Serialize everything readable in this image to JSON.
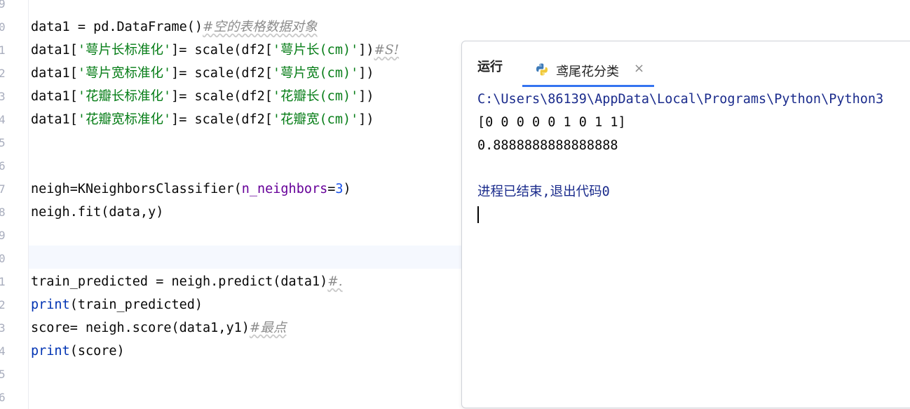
{
  "editor": {
    "line_numbers": [
      "9",
      "0",
      "1",
      "2",
      "3",
      "4",
      "5",
      "6",
      "7",
      "8",
      "9",
      "0",
      "1",
      "2",
      "3",
      "4",
      "5",
      "6"
    ],
    "lines": {
      "l1": {
        "a": "data1 = pd.DataFrame()",
        "c": "#空的表格数据对象"
      },
      "l2": {
        "a": "data1[",
        "s1": "'萼片长标准化'",
        "b": "]= scale(df2[",
        "s2": "'萼片长(cm)'",
        "d": "])",
        "c": "#S!"
      },
      "l3": {
        "a": "data1[",
        "s1": "'萼片宽标准化'",
        "b": "]= scale(df2[",
        "s2": "'萼片宽(cm)'",
        "d": "])"
      },
      "l4": {
        "a": "data1[",
        "s1": "'花瓣长标准化'",
        "b": "]= scale(df2[",
        "s2": "'花瓣长(cm)'",
        "d": "])"
      },
      "l5": {
        "a": "data1[",
        "s1": "'花瓣宽标准化'",
        "b": "]= scale(df2[",
        "s2": "'花瓣宽(cm)'",
        "d": "])"
      },
      "l8": {
        "a": "neigh=KNeighborsClassifier(",
        "p": "n_neighbors",
        "e": "=",
        "n": "3",
        "d": ")"
      },
      "l9": {
        "a": "neigh.fit(data,y)"
      },
      "l12": {
        "a": "train_predicted = neigh.predict(data1)",
        "c": "#."
      },
      "l13": {
        "k": "print",
        "a": "(train_predicted)"
      },
      "l14": {
        "a": "score= neigh.score(data1,y1)",
        "c": "#最点"
      },
      "l15": {
        "k": "print",
        "a": "(score)"
      }
    }
  },
  "run_panel": {
    "title": "运行",
    "tab_label": "鸢尾花分类",
    "tab_close": "×",
    "console_lines": {
      "path": "C:\\Users\\86139\\AppData\\Local\\Programs\\Python\\Python3",
      "predictions": "[0 0 0 0 0 1 0 1 1]",
      "score": "0.8888888888888888",
      "exit": "进程已结束,退出代码0"
    }
  },
  "colors": {
    "string": "#067d17",
    "comment": "#8c8c8c",
    "number": "#1750eb",
    "keyword": "#0033b3",
    "parameter": "#660099",
    "accent": "#3574f0"
  }
}
